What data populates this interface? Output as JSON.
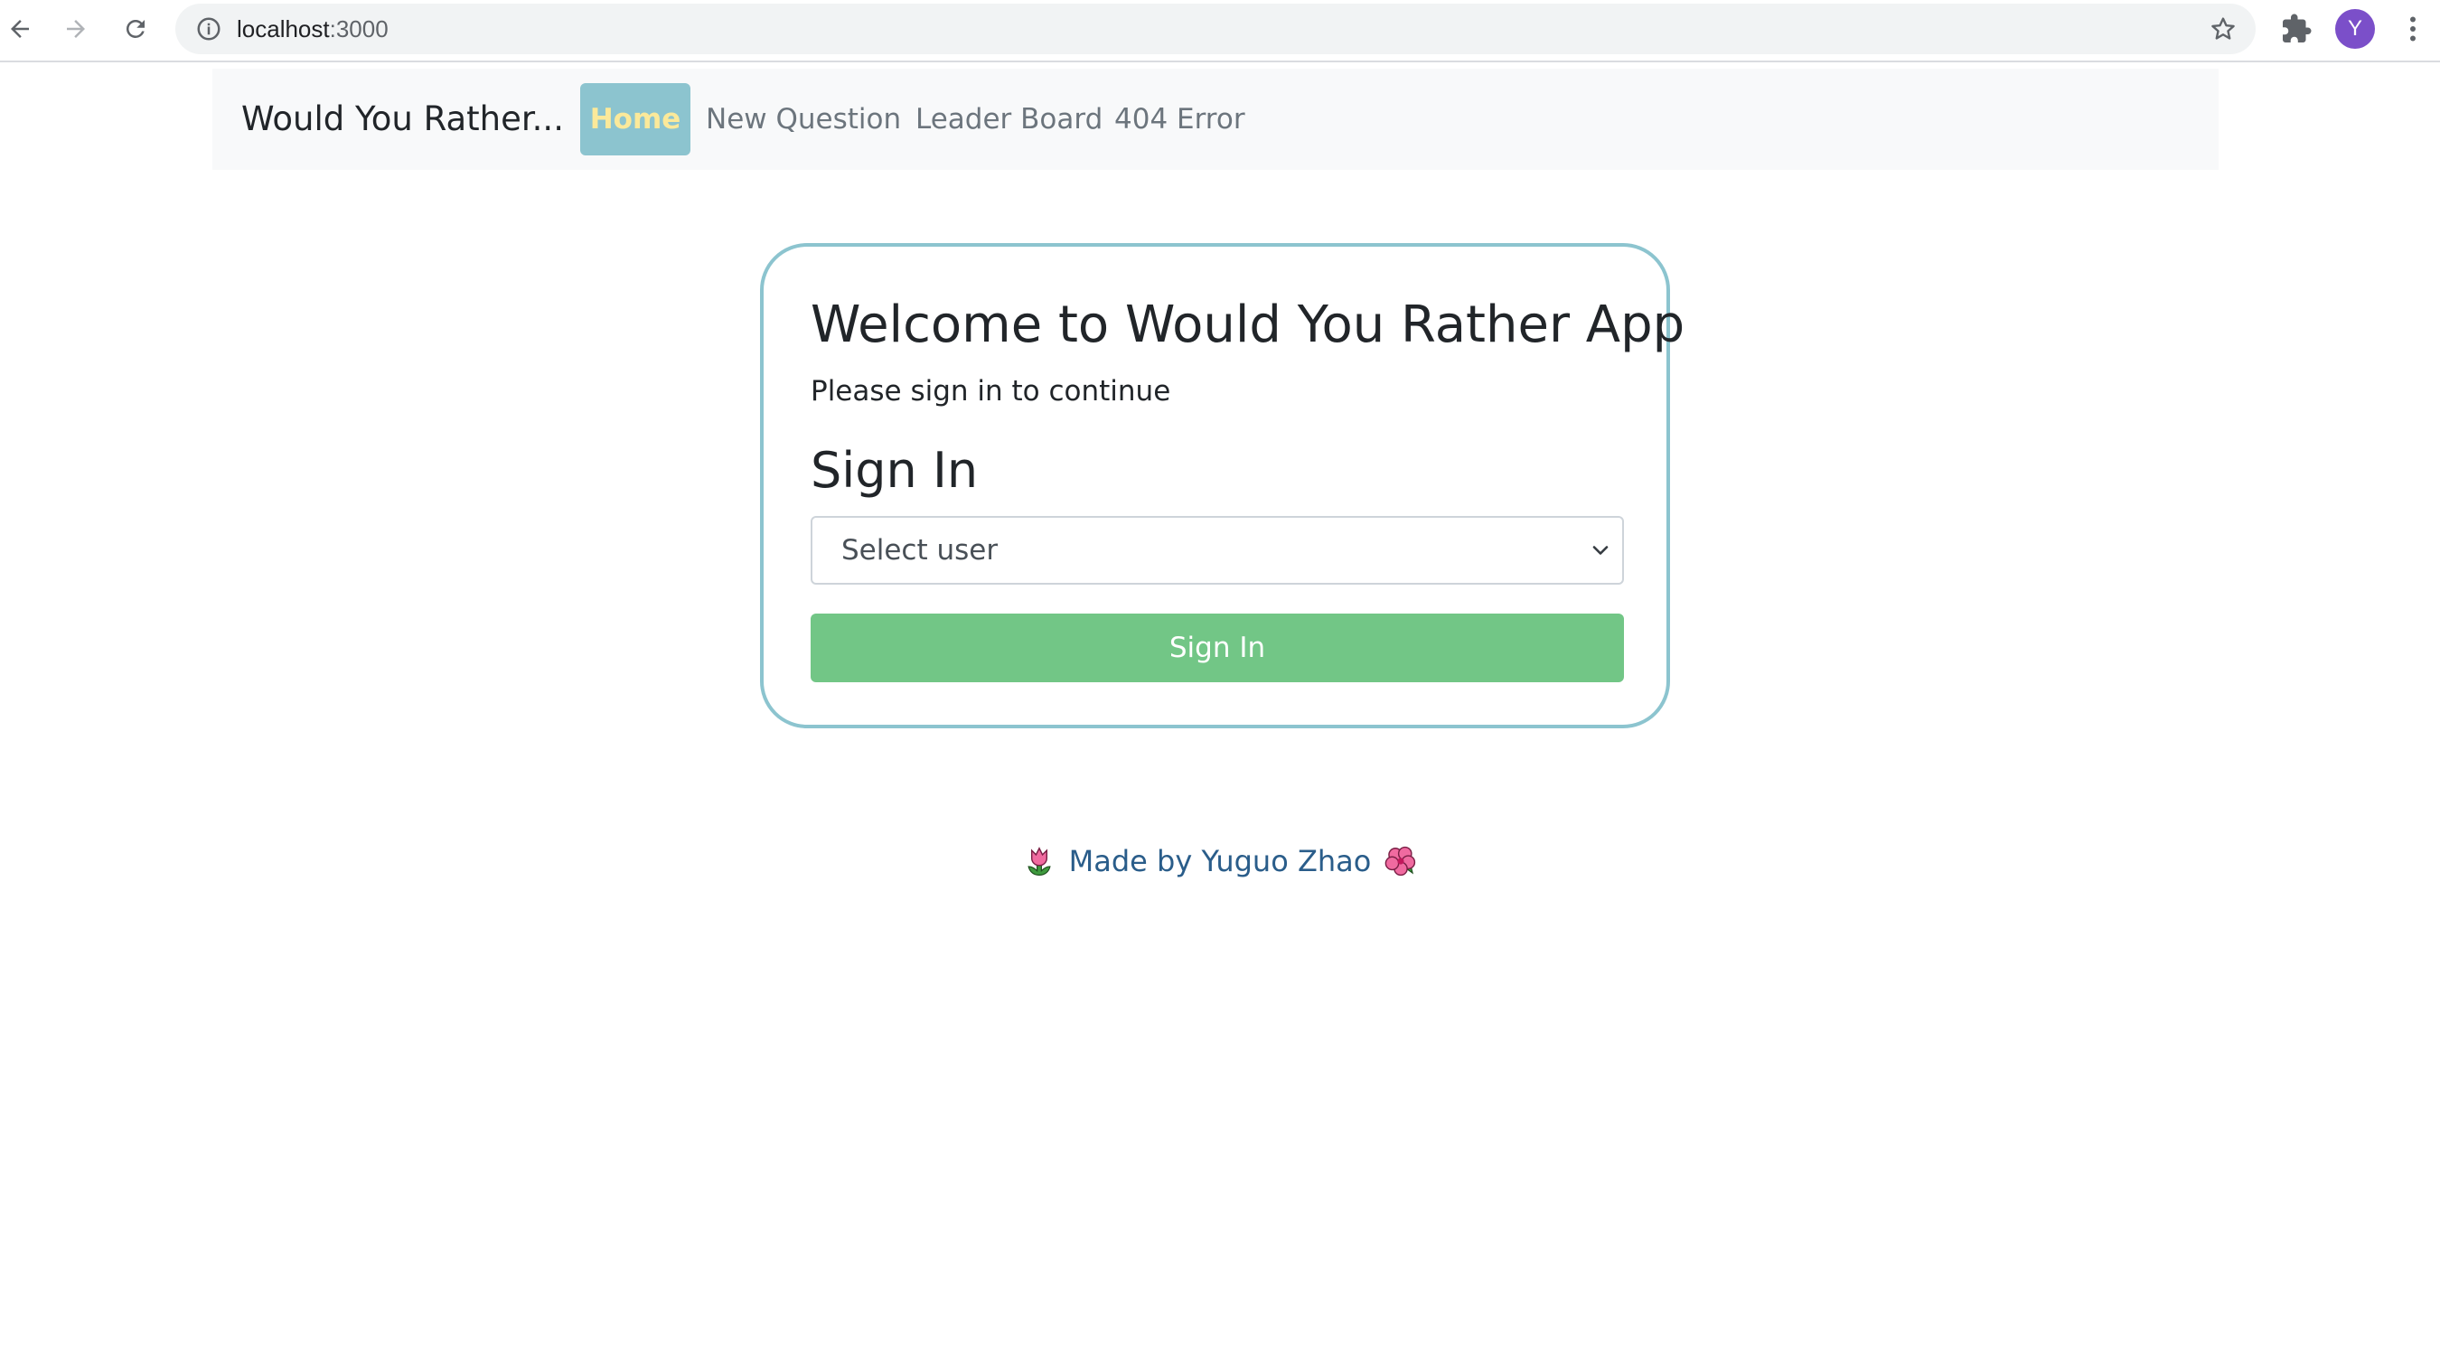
{
  "browser": {
    "url_host": "localhost",
    "url_port": ":3000",
    "avatar_letter": "Y",
    "icons": [
      "back-arrow-icon",
      "forward-arrow-icon",
      "reload-icon",
      "info-icon",
      "star-icon",
      "puzzle-icon",
      "kebab-menu-icon"
    ]
  },
  "navbar": {
    "brand": "Would You Rather...",
    "links": [
      {
        "label": "Home",
        "active": true
      },
      {
        "label": "New Question",
        "active": false
      },
      {
        "label": "Leader Board",
        "active": false
      },
      {
        "label": "404 Error",
        "active": false
      }
    ]
  },
  "card": {
    "title": "Welcome to Would You Rather App",
    "subtitle": "Please sign in to continue",
    "heading": "Sign In",
    "select": {
      "value": "Select user"
    },
    "button_label": "Sign In"
  },
  "footer": {
    "text": "Made by Yuguo Zhao",
    "left_icon": "tulip-icon",
    "right_icon": "hibiscus-icon"
  },
  "colors": {
    "accent": "#8cc4cf",
    "active_text": "#fbe99a",
    "button": "#72c686",
    "footer_text": "#2a5d8a",
    "avatar": "#7b4fc9"
  }
}
